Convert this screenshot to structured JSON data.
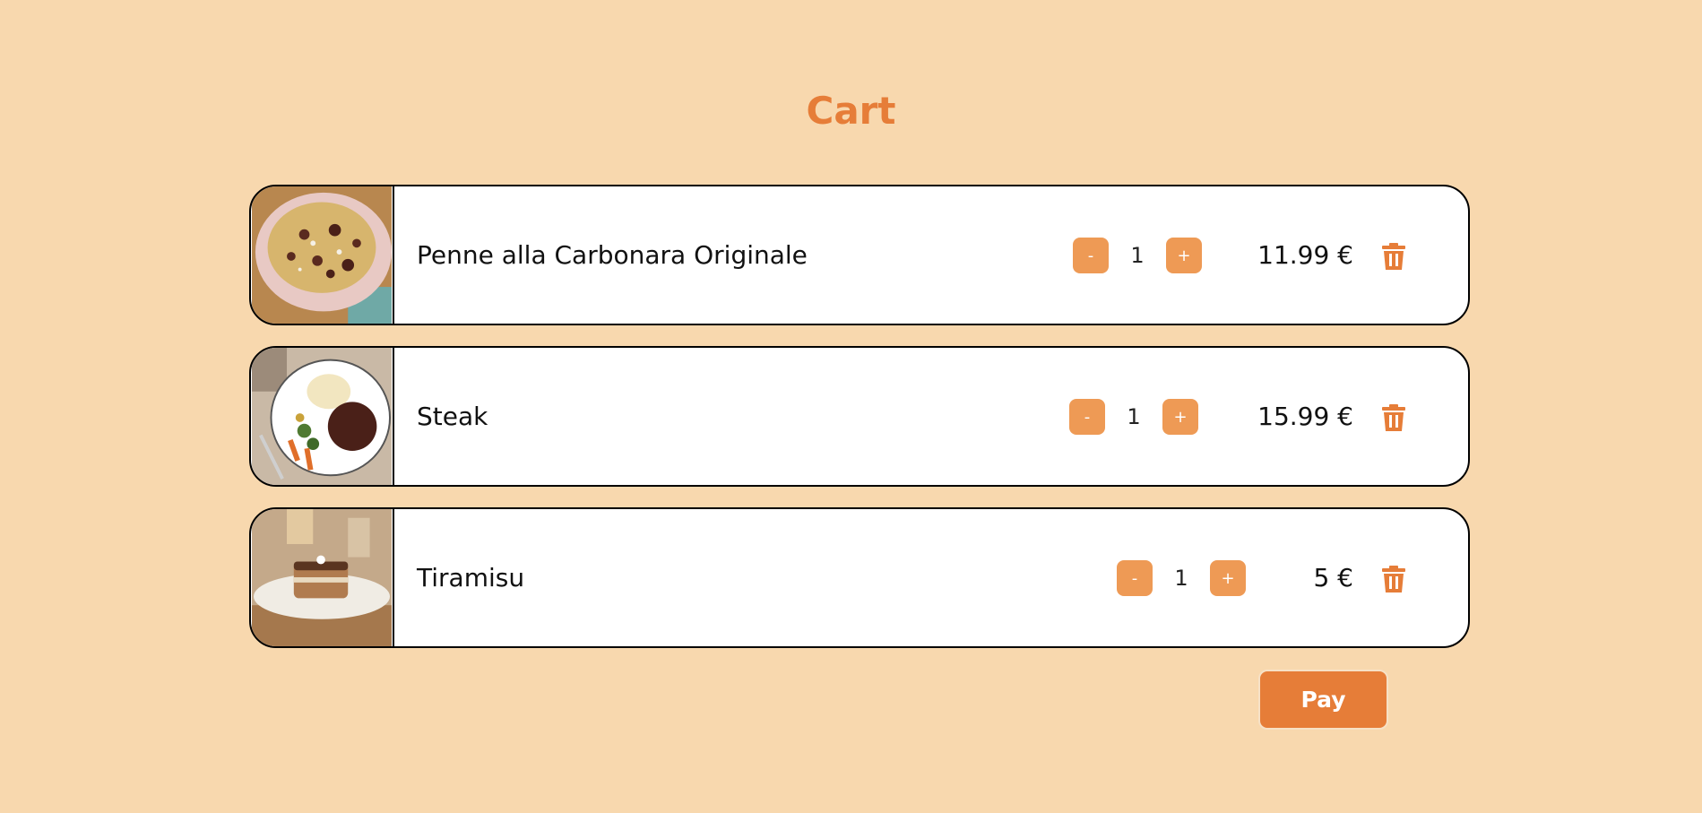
{
  "page": {
    "title": "Cart"
  },
  "colors": {
    "background": "#f8d8ae",
    "accent": "#e67d38",
    "button": "#ee9a55"
  },
  "cart": {
    "items": [
      {
        "name": "Penne alla Carbonara Originale",
        "image_icon": "pasta-carbonara-image",
        "decrement_label": "-",
        "quantity": "1",
        "increment_label": "+",
        "price": "11.99 €",
        "delete_icon": "trash-icon"
      },
      {
        "name": "Steak",
        "image_icon": "steak-plate-image",
        "decrement_label": "-",
        "quantity": "1",
        "increment_label": "+",
        "price": "15.99 €",
        "delete_icon": "trash-icon"
      },
      {
        "name": "Tiramisu",
        "image_icon": "tiramisu-image",
        "decrement_label": "-",
        "quantity": "1",
        "increment_label": "+",
        "price": "5 €",
        "delete_icon": "trash-icon"
      }
    ]
  },
  "actions": {
    "pay_label": "Pay"
  }
}
